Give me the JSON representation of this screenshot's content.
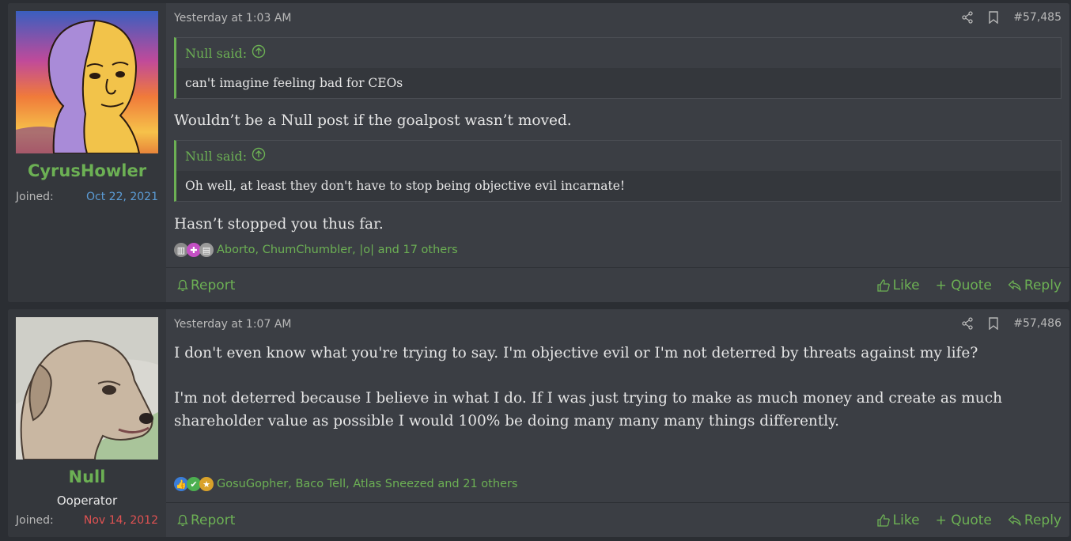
{
  "posts": [
    {
      "username": "CyrusHowler",
      "user_title": "",
      "joined_label": "Joined:",
      "joined_date": "Oct 22, 2021",
      "date": "Yesterday at 1:03 AM",
      "post_number": "#57,485",
      "quotes": [
        {
          "author": "Null said:",
          "text": "can't imagine feeling bad for CEOs"
        },
        {
          "author": "Null said:",
          "text": "Oh well, at least they don't have to stop being objective evil incarnate!"
        }
      ],
      "replies": [
        "Wouldn’t be a Null post if the goalpost wasn’t moved.",
        "Hasn’t stopped you thus far."
      ],
      "reactions_text": "Aborto, ChumChumbler, |o| and 17 others",
      "actions": {
        "report": "Report",
        "like": "Like",
        "quote": "+ Quote",
        "reply": "Reply"
      }
    },
    {
      "username": "Null",
      "user_title": "Ooperator",
      "joined_label": "Joined:",
      "joined_date": "Nov 14, 2012",
      "date": "Yesterday at 1:07 AM",
      "post_number": "#57,486",
      "paragraphs": [
        "I don't even know what you're trying to say. I'm objective evil or I'm not deterred by threats against my life?",
        "I'm not deterred because I believe in what I do. If I was just trying to make as much money and create as much shareholder value as possible I would 100% be doing many many many things differently."
      ],
      "reactions_text": "GosuGopher, Baco Tell, Atlas Sneezed and 21 others",
      "actions": {
        "report": "Report",
        "like": "Like",
        "quote": "+ Quote",
        "reply": "Reply"
      }
    }
  ],
  "colors": {
    "accent": "#6cb054",
    "background": "#2b2e33",
    "post_bg": "#3b3e44",
    "joined_blue": "#5b9bd5",
    "joined_red": "#e05252"
  }
}
